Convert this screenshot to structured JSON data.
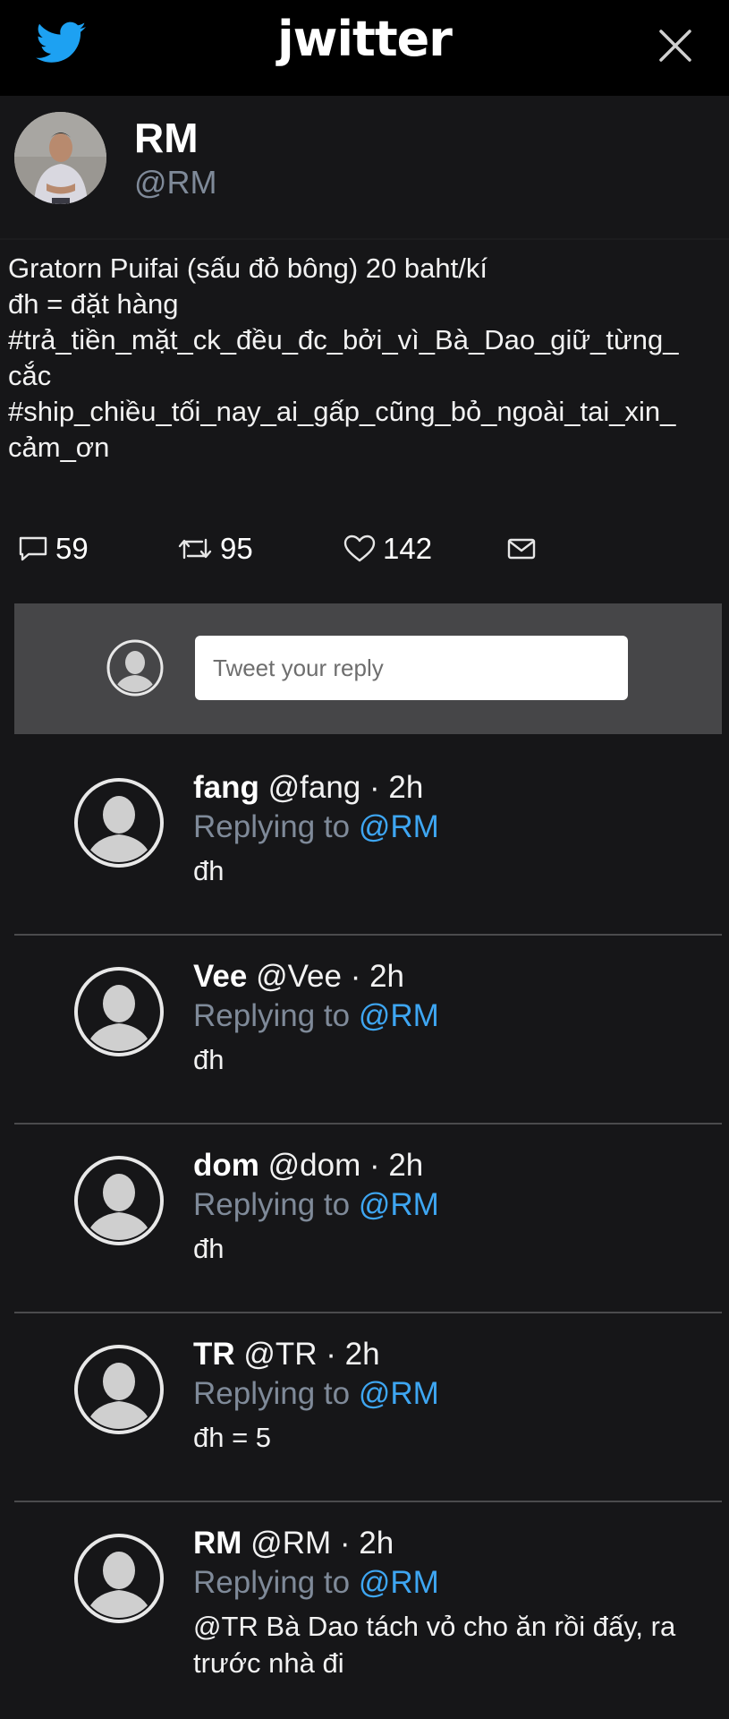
{
  "app": {
    "brand": "jwitter",
    "icons": {
      "logo": "bird-icon",
      "close": "close-icon"
    },
    "colors": {
      "bird": "#1DA1F2",
      "link": "#3EA6F2",
      "muted": "#7F8A99",
      "background": "#161618"
    }
  },
  "tweet": {
    "author_name": "RM",
    "author_handle": "@RM",
    "text_lines": [
      "Gratorn Puifai (sấu đỏ bông) 20 baht/kí",
      "đh = đặt hàng",
      "#trả_tiền_mặt_ck_đều_đc_bởi_vì_Bà_Dao_giữ_từng_",
      "cắc",
      "#ship_chiều_tối_nay_ai_gấp_cũng_bỏ_ngoài_tai_xin_",
      "cảm_ơn"
    ],
    "stats": {
      "replies": "59",
      "retweets": "95",
      "likes": "142"
    }
  },
  "reply_box": {
    "placeholder": "Tweet your reply"
  },
  "replies": [
    {
      "name": "fang",
      "meta": "@fang · 2h",
      "replying_prefix": "Replying to",
      "replying_to": "@RM",
      "text": "đh"
    },
    {
      "name": "Vee",
      "meta": "@Vee · 2h",
      "replying_prefix": "Replying to",
      "replying_to": "@RM",
      "text": "đh"
    },
    {
      "name": "dom",
      "meta": "@dom · 2h",
      "replying_prefix": "Replying to",
      "replying_to": "@RM",
      "text": "đh"
    },
    {
      "name": "TR",
      "meta": "@TR · 2h",
      "replying_prefix": "Replying to",
      "replying_to": "@RM",
      "text": "đh = 5"
    },
    {
      "name": "RM",
      "meta": "@RM · 2h",
      "replying_prefix": "Replying to",
      "replying_to": "@RM",
      "text": "@TR Bà Dao tách vỏ cho ăn rồi đấy, ra trước nhà đi"
    }
  ]
}
